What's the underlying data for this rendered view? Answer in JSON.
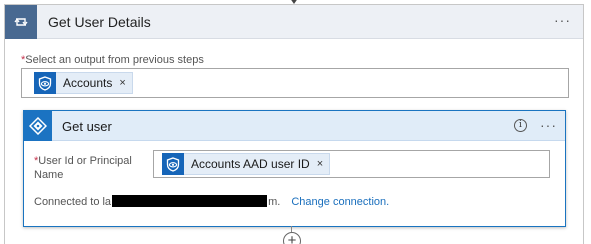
{
  "loop_card": {
    "title": "Get User Details",
    "menu_label": "···",
    "required_star": "*",
    "field_label": "Select an output from previous steps",
    "token": {
      "label": "Accounts",
      "remove": "×"
    }
  },
  "action_card": {
    "title": "Get user",
    "info_label": "i",
    "menu_label": "···",
    "user_field": {
      "required_star": "*",
      "label": "User Id or Principal Name",
      "token": {
        "label": "Accounts AAD user ID",
        "remove": "×"
      }
    },
    "connection": {
      "prefix": "Connected to la",
      "suffix": "m.",
      "link": "Change connection."
    }
  },
  "add_step_label": "+",
  "colors": {
    "loop_tile": "#486991",
    "aad_tile": "#1b73c2",
    "token_icon": "#1665b8",
    "link": "#1a6fbd",
    "required": "#c4314b"
  },
  "icons": {
    "loop": "loop-icon",
    "aad": "azure-ad-diamond-icon",
    "token": "shield-eye-icon"
  }
}
